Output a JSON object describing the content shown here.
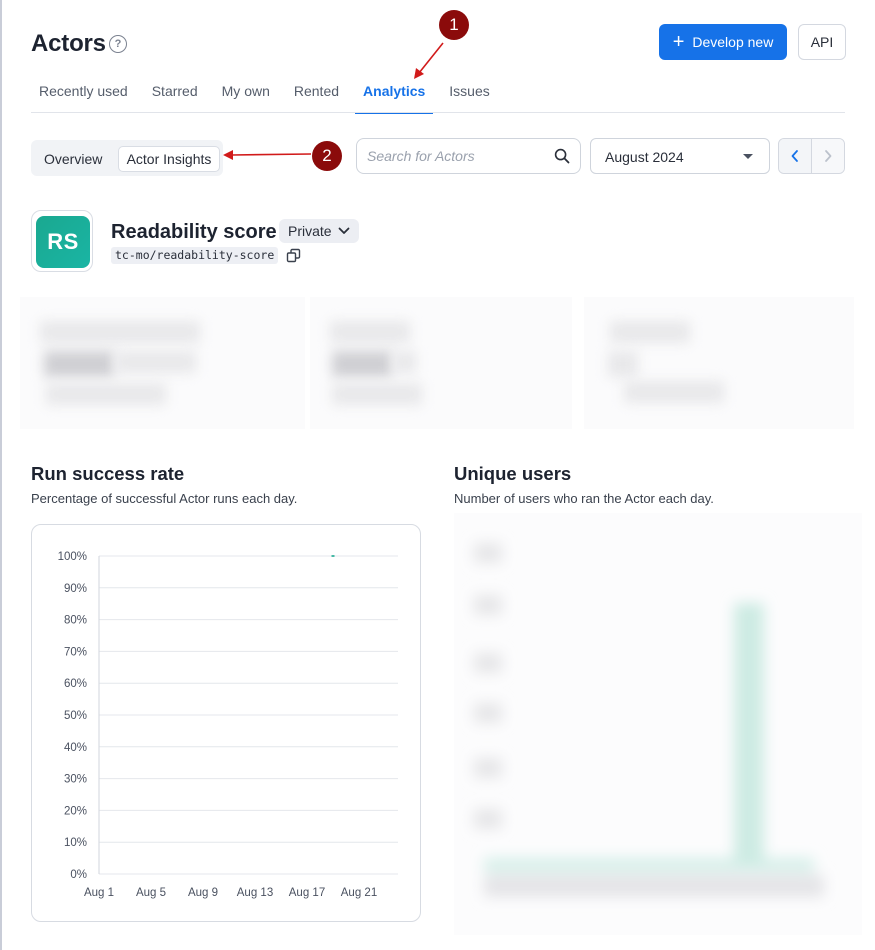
{
  "header": {
    "title": "Actors",
    "develop_label": "Develop new",
    "api_label": "API"
  },
  "tabs": [
    {
      "label": "Recently used",
      "active": false
    },
    {
      "label": "Starred",
      "active": false
    },
    {
      "label": "My own",
      "active": false
    },
    {
      "label": "Rented",
      "active": false
    },
    {
      "label": "Analytics",
      "active": true
    },
    {
      "label": "Issues",
      "active": false
    }
  ],
  "view_switch": {
    "overview_label": "Overview",
    "insights_label": "Actor Insights"
  },
  "search": {
    "placeholder": "Search for Actors"
  },
  "month_select": {
    "value": "August 2024"
  },
  "annotations": {
    "marker_1": "1",
    "marker_2": "2"
  },
  "actor": {
    "initials": "RS",
    "name": "Readability score",
    "visibility": "Private",
    "slug": "tc-mo/readability-score"
  },
  "run_success": {
    "title": "Run success rate",
    "subtitle": "Percentage of successful Actor runs each day."
  },
  "unique_users": {
    "title": "Unique users",
    "subtitle": "Number of users who ran the Actor each day."
  },
  "colors": {
    "accent": "#1672e8",
    "annotation": "#8b0b0b",
    "chart_line": "#1aa890"
  },
  "chart_data": [
    {
      "type": "line",
      "title": "Run success rate",
      "x_ticks": [
        "Aug 1",
        "Aug 5",
        "Aug 9",
        "Aug 13",
        "Aug 17",
        "Aug 21"
      ],
      "y_ticks": [
        "0%",
        "10%",
        "20%",
        "30%",
        "40%",
        "50%",
        "60%",
        "70%",
        "80%",
        "90%",
        "100%"
      ],
      "ylim": [
        0,
        100
      ],
      "xlim": [
        1,
        24
      ],
      "grid": true,
      "series": [
        {
          "x": [
            19
          ],
          "y": [
            100
          ]
        }
      ]
    }
  ]
}
